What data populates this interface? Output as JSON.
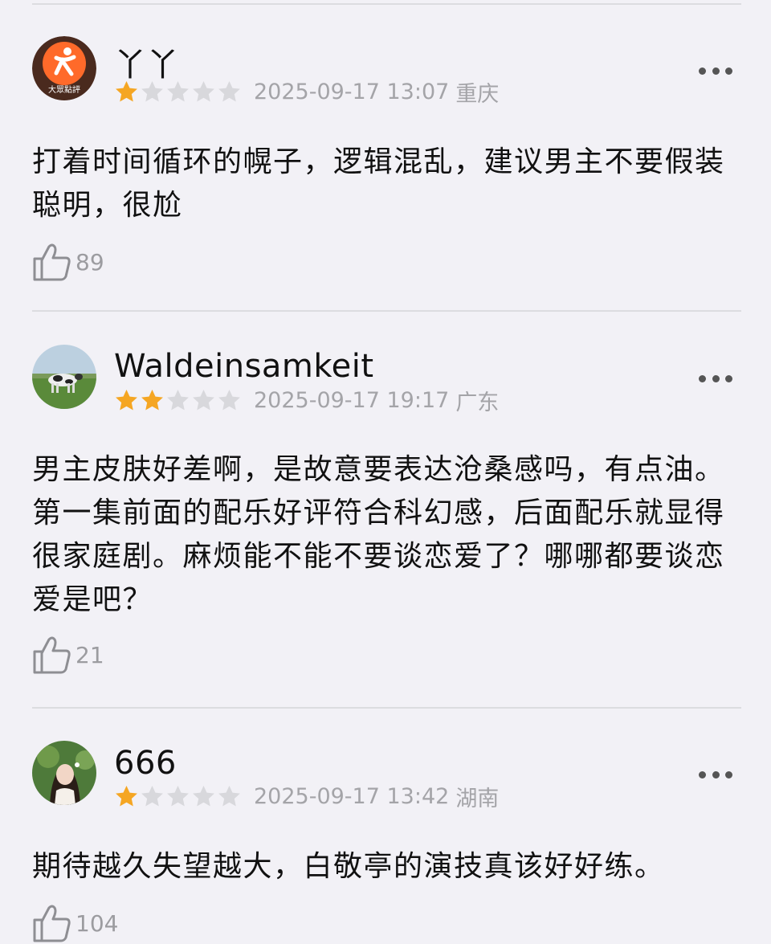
{
  "reviews": [
    {
      "username": "丫丫",
      "avatar_label": "大眾點評",
      "rating": 1,
      "date": "2025-09-17 13:07",
      "region": "重庆",
      "text": "打着时间循环的幌子，逻辑混乱，建议男主不要假装聪明，很尬",
      "likes": "89"
    },
    {
      "username": "Waldeinsamkeit",
      "rating": 2,
      "date": "2025-09-17 19:17",
      "region": "广东",
      "text": "男主皮肤好差啊，是故意要表达沧桑感吗，有点油。第一集前面的配乐好评符合科幻感，后面配乐就显得很家庭剧。麻烦能不能不要谈恋爱了？哪哪都要谈恋爱是吧？",
      "likes": "21"
    },
    {
      "username": "666",
      "rating": 1,
      "date": "2025-09-17 13:42",
      "region": "湖南",
      "text": "期待越久失望越大，白敬亭的演技真该好好练。",
      "likes": "104"
    }
  ],
  "colors": {
    "star_filled": "#f5a623",
    "star_empty": "#d8d8dc",
    "background": "#f2f1f6",
    "meta_text": "#a4a4a8"
  },
  "icons": {
    "like": "thumbs-up-icon",
    "more": "more-dots-icon"
  }
}
